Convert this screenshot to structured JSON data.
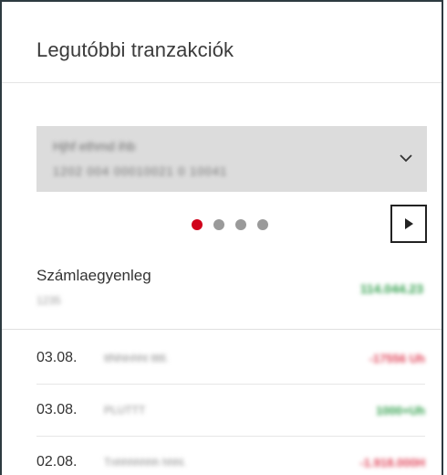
{
  "widget": {
    "title": "Legutóbbi tranzakciók"
  },
  "account_selector": {
    "account_name": "Hjhf ethmd ihb",
    "account_number": "1202 004 00010021 0 10041",
    "dropdown_icon": "chevron-down-icon"
  },
  "carousel": {
    "page_count": 4,
    "active_index": 0,
    "next_icon": "triangle-right-icon"
  },
  "balance": {
    "label": "Számlaegyenleg",
    "sublabel": "1235",
    "amount": "114.044.23"
  },
  "transactions": [
    {
      "date": "03.08.",
      "description": "ttNhlnhht ttttl.",
      "amount": "-17556 Uh",
      "direction": "negative"
    },
    {
      "date": "03.08.",
      "description": "PLUTTT",
      "amount": "1000+Uh",
      "direction": "positive"
    },
    {
      "date": "02.08.",
      "description": "Tnhhhhhhh hhhl.",
      "amount": "-1.918.000H",
      "direction": "negative"
    }
  ],
  "colors": {
    "accent_red": "#d0021b",
    "positive": "#2f9e4a",
    "negative": "#e0455a",
    "frame": "#2d3a40"
  }
}
